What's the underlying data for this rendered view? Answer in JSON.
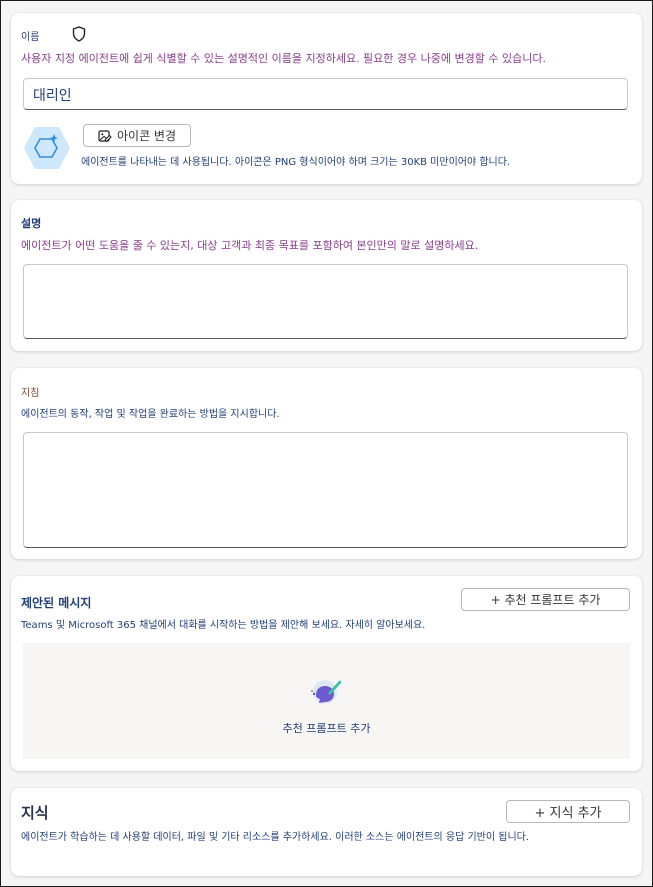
{
  "name_section": {
    "label": "이름",
    "description": "사용자 지정 에이전트에 쉽게 식별할 수 있는 설명적인 이름을 지정하세요. 필요한 경우 나중에 변경할 수 있습니다.",
    "input_value": "대리인",
    "change_icon_button": "아이콘 변경",
    "icon_help": "에이전트를 나타내는 데 사용됩니다. 아이콘은 PNG 형식이어야 하며 크기는 30KB 미만이어야 합니다."
  },
  "description_section": {
    "label": "설명",
    "description": "에이전트가 어떤 도움을 줄 수 있는지, 대상 고객과 최종 목표를 포함하여 본인만의 말로 설명하세요.",
    "input_value": ""
  },
  "instructions_section": {
    "label": "지침",
    "description": "에이전트의 동작, 작업 및 작업을 완료하는 방법을 지시합니다.",
    "input_value": ""
  },
  "suggested_section": {
    "label": "제안된 메시지",
    "add_button": "+ 추천 프롬프트 추가",
    "description": "Teams 및 Microsoft 365 채널에서 대화를 시작하는 방법을 제안해 보세요. 자세히 알아보세요.",
    "empty_link": "추천 프롬프트 추가"
  },
  "knowledge_section": {
    "label": "지식",
    "add_button": "+ 지식 추가",
    "description": "에이전트가 학습하는 데 사용할 데이터, 파일 및 기타 리소스를 추가하세요. 이러한 소스는 에이전트의 응답 기반이 됩니다."
  },
  "colors": {
    "accent_purple": "#8a3e8f",
    "accent_blue": "#1f3f78",
    "label_brown": "#7a4b3a",
    "icon_hex": "#cfe7fb"
  },
  "icons": [
    "shield-icon",
    "agent-hexagon-icon",
    "image-edit-icon",
    "chat-brush-icon"
  ]
}
